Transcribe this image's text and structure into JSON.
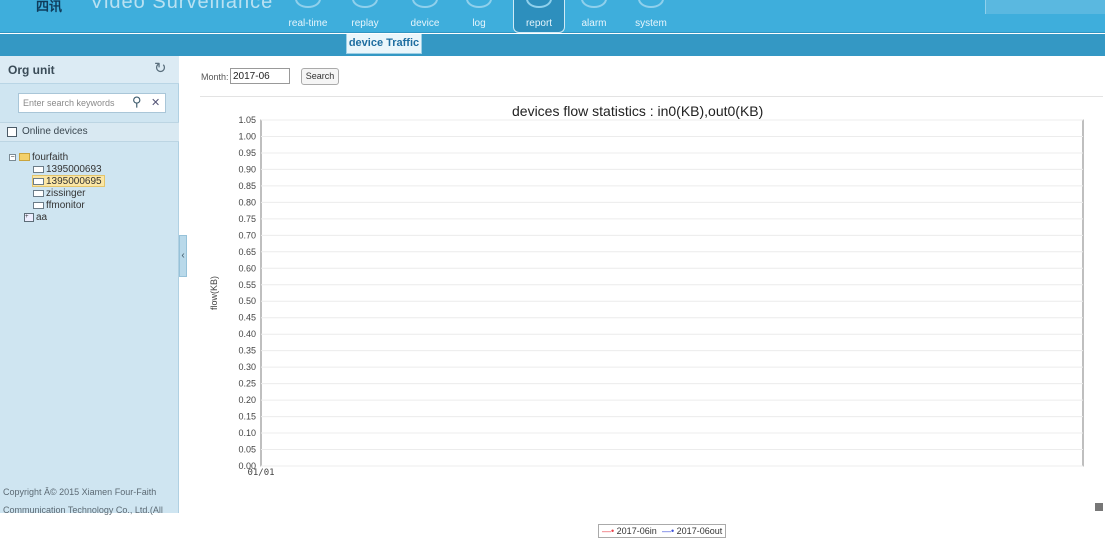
{
  "app": {
    "logo_text": "Video Surveillance",
    "logo_mark": "四讯"
  },
  "nav": {
    "items": [
      {
        "label": "real-time"
      },
      {
        "label": "replay"
      },
      {
        "label": "device"
      },
      {
        "label": "log"
      },
      {
        "label": "report"
      },
      {
        "label": "alarm"
      },
      {
        "label": "system"
      }
    ],
    "active": "report"
  },
  "subtab": {
    "label": "device Traffic"
  },
  "sidebar": {
    "title": "Org unit",
    "refresh_icon": "refresh-icon",
    "search_placeholder": "Enter search keywords",
    "online_label": "Online devices",
    "tree": {
      "root": "fourfaith",
      "devices": [
        "1395000693",
        "1395000695",
        "zissinger",
        "ffmonitor"
      ],
      "selected": "1395000695",
      "group": "aa"
    },
    "copyright_line1": "Copyright Â© 2015 Xiamen Four-Faith",
    "copyright_line2": "Communication Technology Co., Ltd.(All"
  },
  "filter": {
    "month_label": "Month:",
    "month_value": "2017-06",
    "search_label": "Search"
  },
  "chart_data": {
    "type": "line",
    "title": "devices flow statistics : in0(KB),out0(KB)",
    "ylabel": "flow(KB)",
    "xlabel": "",
    "categories": [
      "01/01"
    ],
    "ylim": [
      0,
      1.05
    ],
    "yticks": [
      "0.00",
      "0.05",
      "0.10",
      "0.15",
      "0.20",
      "0.25",
      "0.30",
      "0.35",
      "0.40",
      "0.45",
      "0.50",
      "0.55",
      "0.60",
      "0.65",
      "0.70",
      "0.75",
      "0.80",
      "0.85",
      "0.90",
      "0.95",
      "1.00",
      "1.05"
    ],
    "grid": true,
    "legend": "bottom-center",
    "series": [
      {
        "name": "2017-06in",
        "color": "#e8414a",
        "values": []
      },
      {
        "name": "2017-06out",
        "color": "#3d4fd8",
        "values": []
      }
    ]
  },
  "colors": {
    "topbar": "#3eaedc",
    "sidebar": "#cfe5f1",
    "accent": "#1f6ea0"
  }
}
